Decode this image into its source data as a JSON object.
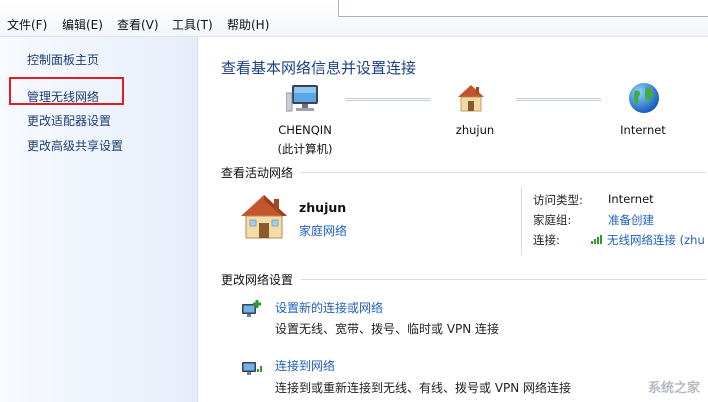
{
  "menubar": {
    "items": [
      "文件(F)",
      "编辑(E)",
      "查看(V)",
      "工具(T)",
      "帮助(H)"
    ]
  },
  "sidebar": {
    "items": [
      "控制面板主页",
      "管理无线网络",
      "更改适配器设置",
      "更改高级共享设置"
    ]
  },
  "main": {
    "title": "查看基本网络信息并设置连接",
    "map": {
      "computer": {
        "name": "CHENQIN",
        "sub": "(此计算机)"
      },
      "router": {
        "name": "zhujun"
      },
      "internet": {
        "name": "Internet"
      }
    },
    "active_section": "查看活动网络",
    "active": {
      "name": "zhujun",
      "type": "家庭网络",
      "access_key": "访问类型:",
      "access_val": "Internet",
      "homegroup_key": "家庭组:",
      "homegroup_val": "准备创建",
      "conn_key": "连接:",
      "conn_val": "无线网络连接 (zhu"
    },
    "change_section": "更改网络设置",
    "tasks": [
      {
        "link": "设置新的连接或网络",
        "desc": "设置无线、宽带、拨号、临时或 VPN 连接"
      },
      {
        "link": "连接到网络",
        "desc": "连接到或重新连接到无线、有线、拨号或 VPN 网络连接"
      }
    ]
  },
  "watermark": "系统之家",
  "colors": {
    "link": "#1f5fbf",
    "title": "#1e3f8a",
    "highlight": "#e01c24"
  }
}
